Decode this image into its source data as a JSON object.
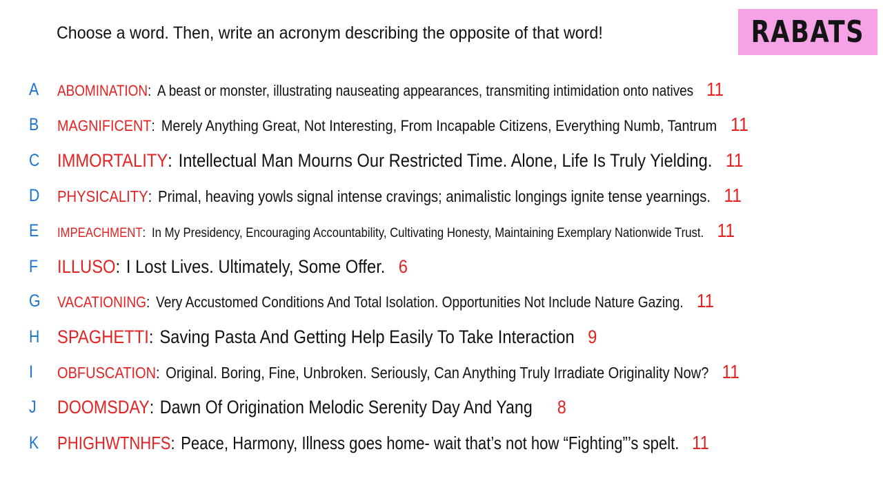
{
  "header": {
    "instruction": "Choose a word. Then, write an acronym describing the opposite of that word!",
    "badge": "RABATS"
  },
  "entries": [
    {
      "letter": "A",
      "word": "ABOMINATION",
      "definition": "A beast or monster, illustrating nauseating appearances, transmiting intimidation onto natives",
      "count": "11"
    },
    {
      "letter": "B",
      "word": "MAGNIFICENT",
      "definition": "Merely Anything Great, Not Interesting, From Incapable Citizens, Everything Numb, Tantrum",
      "count": "11"
    },
    {
      "letter": "C",
      "word": "IMMORTALITY",
      "definition": "Intellectual Man Mourns Our Restricted Time. Alone, Life Is Truly Yielding.",
      "count": "11"
    },
    {
      "letter": "D",
      "word": "PHYSICALITY",
      "definition": "Primal, heaving yowls signal intense cravings; animalistic longings ignite tense yearnings.",
      "count": "11"
    },
    {
      "letter": "E",
      "word": "IMPEACHMENT",
      "definition": "In My Presidency, Encouraging Accountability, Cultivating Honesty, Maintaining Exemplary Nationwide Trust.",
      "count": "11"
    },
    {
      "letter": "F",
      "word": "ILLUSO",
      "definition": "I Lost Lives. Ultimately, Some Offer.",
      "count": "6"
    },
    {
      "letter": "G",
      "word": "VACATIONING",
      "definition": "Very Accustomed Conditions And Total Isolation. Opportunities Not Include Nature Gazing.",
      "count": "11"
    },
    {
      "letter": "H",
      "word": "SPAGHETTI",
      "definition": "Saving Pasta And Getting Help Easily To Take Interaction",
      "count": "9"
    },
    {
      "letter": "I",
      "word": "OBFUSCATION",
      "definition": "Original. Boring, Fine, Unbroken. Seriously, Can Anything Truly Irradiate Originality Now?",
      "count": "11"
    },
    {
      "letter": "J",
      "word": "DOOMSDAY",
      "definition": "Dawn Of Origination Melodic Serenity Day And Yang",
      "count": "8"
    },
    {
      "letter": "K",
      "word": "PHIGHWTNHFS",
      "definition": "Peace, Harmony, Illness goes home- wait that’s not how “Fighting”’s spelt.",
      "count": "11"
    }
  ]
}
